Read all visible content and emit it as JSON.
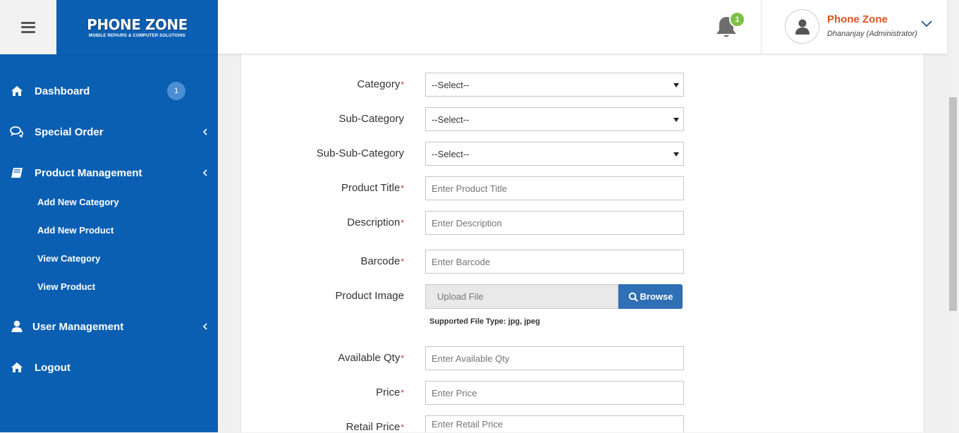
{
  "header": {
    "logo_brand": "PHONE ZONE",
    "logo_tagline": "MOBILE REPAIRS & COMPUTER SOLUTIONS",
    "notification_count": "1",
    "user_name": "Phone Zone",
    "user_role": "Dhananjay (Administrator)"
  },
  "sidebar": {
    "items": [
      {
        "label": "Dashboard",
        "icon": "home-icon",
        "badge": "1"
      },
      {
        "label": "Special Order",
        "icon": "comments-icon"
      },
      {
        "label": "Product Management",
        "icon": "book-icon"
      },
      {
        "label": "User Management",
        "icon": "user-icon"
      },
      {
        "label": "Logout",
        "icon": "home-icon"
      }
    ],
    "sub_items": [
      "Add New Category",
      "Add New Product",
      "View Category",
      "View Product"
    ]
  },
  "form": {
    "category": {
      "label": "Category",
      "value": "--Select--"
    },
    "sub_category": {
      "label": "Sub-Category",
      "value": "--Select--"
    },
    "sub_sub_category": {
      "label": "Sub-Sub-Category",
      "value": "--Select--"
    },
    "product_title": {
      "label": "Product Title",
      "placeholder": "Enter Product Title"
    },
    "description": {
      "label": "Description",
      "placeholder": "Enter Description"
    },
    "barcode": {
      "label": "Barcode",
      "placeholder": "Enter Barcode"
    },
    "product_image": {
      "label": "Product Image",
      "placeholder": "Upload File",
      "button": "Browse",
      "hint": "Supported File Type: jpg, jpeg"
    },
    "available_qty": {
      "label": "Available Qty",
      "placeholder": "Enter Available Qty"
    },
    "price": {
      "label": "Price",
      "placeholder": "Enter Price"
    },
    "retail_price": {
      "label": "Retail Price",
      "placeholder": "Enter Retail Price"
    },
    "required_mark": "*"
  },
  "colors": {
    "sidebar_bg": "#0b5fb3",
    "accent_orange": "#d9541e",
    "badge_green": "#7cc242",
    "browse_button": "#2f6fb3"
  }
}
